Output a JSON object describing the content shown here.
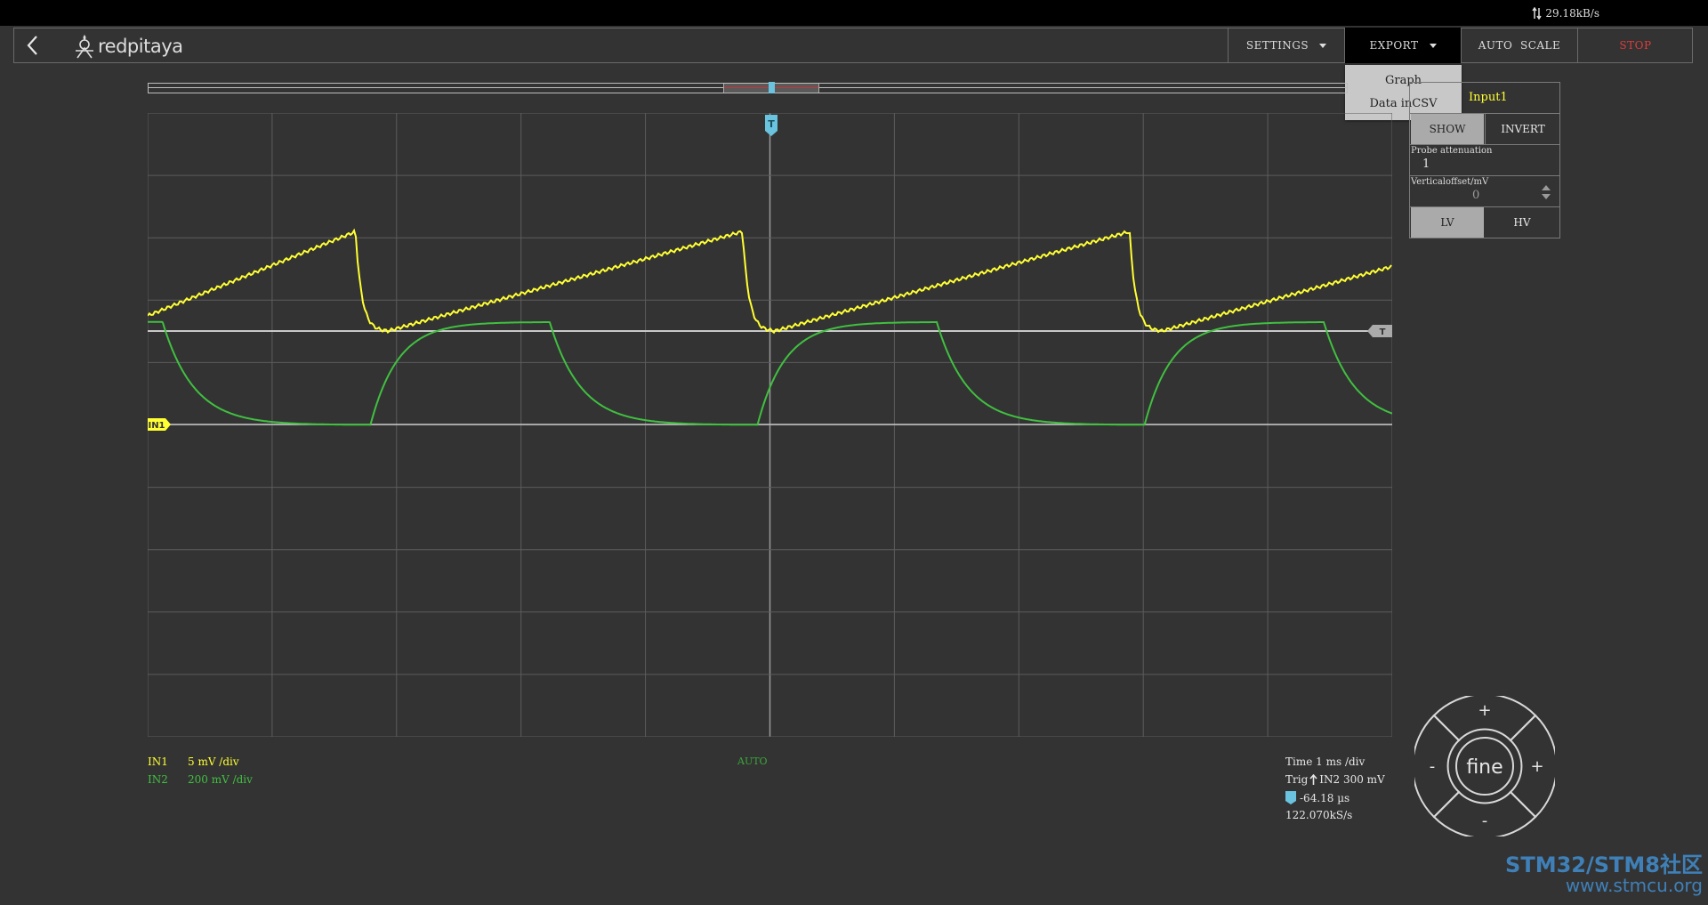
{
  "status": {
    "net_speed": "29.18kB/s",
    "net_icon": "up-down-arrows-icon"
  },
  "navbar": {
    "back_icon": "chevron-left-icon",
    "logo_text": "redpitaya",
    "settings_label": "SETTINGS",
    "export_label": "EXPORT",
    "autoscale_label": "AUTO  SCALE",
    "stop_label": "STOP"
  },
  "export_menu": {
    "items": [
      "Graph",
      "Data inCSV"
    ]
  },
  "panel": {
    "title": "Input1",
    "show_label": "SHOW",
    "invert_label": "INVERT",
    "probe_label": "Probe attenuation",
    "probe_value": "1",
    "offset_label": "Verticaloffset/mV",
    "offset_value": "0",
    "lv_label": "LV",
    "hv_label": "HV"
  },
  "info": {
    "in1_name": "IN1",
    "in1_scale": "5 mV /div",
    "in2_name": "IN2",
    "in2_scale": "200 mV /div",
    "mode": "AUTO",
    "time": "Time 1 ms /div",
    "trig_prefix": "Trig",
    "trig_value": "IN2 300 mV",
    "trig_time": "-64.18 µs",
    "sample_rate": "122.070kS/s"
  },
  "nav_wheel": {
    "center_label": "fine",
    "up": "+",
    "down": "-",
    "left": "-",
    "right": "+"
  },
  "markers": {
    "in1_marker": "IN1",
    "trigger_marker": "T"
  },
  "watermark": {
    "line1": "STM32/STM8社区",
    "line2": "www.stmcu.org"
  },
  "colors": {
    "background": "#333333",
    "grid": "#5c5c5c",
    "in1": "#ffff33",
    "in2": "#40c040",
    "trigger": "#6ac3df",
    "stop": "#e03c3c",
    "green_label": "#3aa83a"
  },
  "chart_data": {
    "type": "line",
    "x_divisions": 10,
    "y_divisions": 10,
    "grid": true,
    "series": [
      {
        "name": "IN1",
        "shape": "sawtooth",
        "period_div": 3.11,
        "phase_div": 1.67,
        "high_div": 2.6,
        "low_div": 1.0,
        "start_div": 0.0
      },
      {
        "name": "IN2",
        "shape": "square-rc",
        "period_div": 3.11,
        "rise_div": 1.67,
        "fall_div": 0.12,
        "high_div": 1.65,
        "low_div": 0.0
      }
    ]
  }
}
